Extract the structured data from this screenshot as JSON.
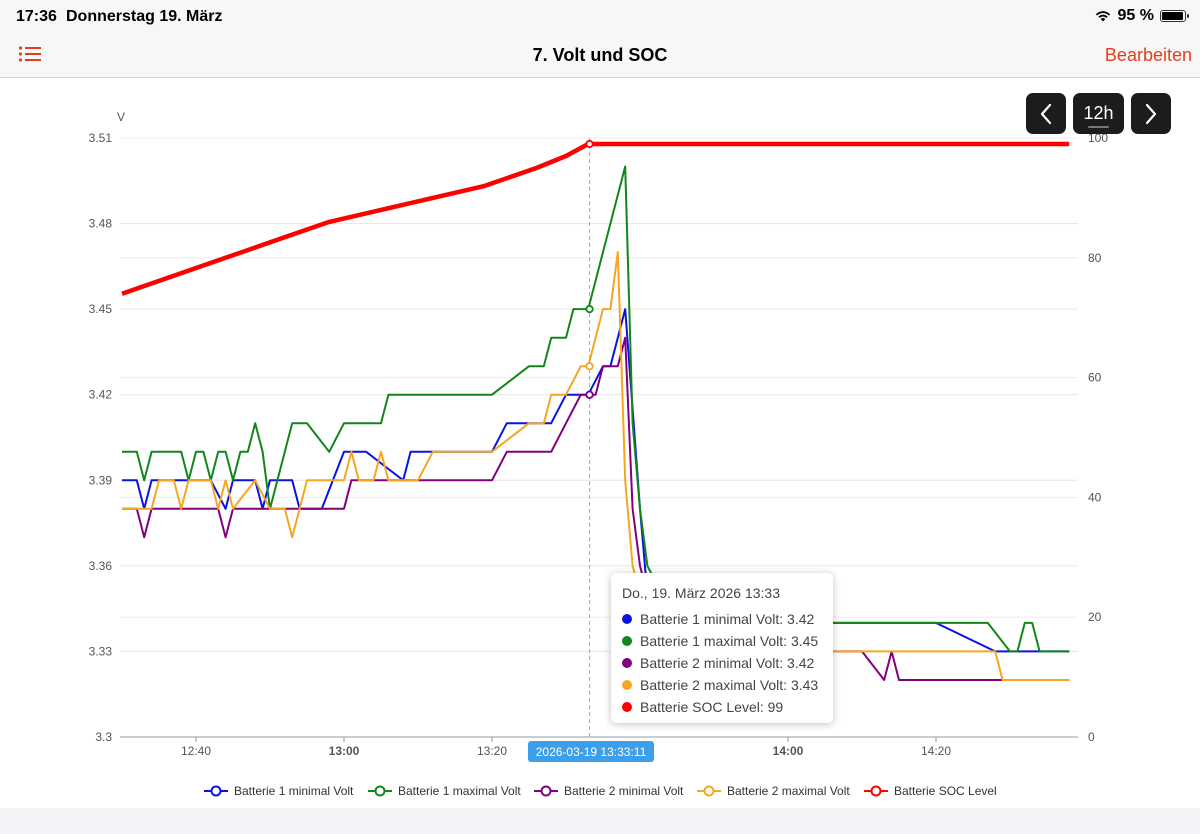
{
  "status": {
    "time": "17:36",
    "date": "Donnerstag 19. März",
    "battery": "95 %"
  },
  "nav": {
    "title": "7. Volt und SOC",
    "edit_label": "Bearbeiten"
  },
  "controls": {
    "range_label": "12h"
  },
  "tooltip": {
    "title": "Do., 19. März 2026 13:33",
    "rows": [
      {
        "label": "Batterie 1 minimal Volt: 3.42",
        "color": "#0a14e0"
      },
      {
        "label": "Batterie 1 maximal Volt: 3.45",
        "color": "#12861a"
      },
      {
        "label": "Batterie 2 minimal Volt: 3.42",
        "color": "#800080"
      },
      {
        "label": "Batterie 2 maximal Volt: 3.43",
        "color": "#f5a623"
      },
      {
        "label": "Batterie SOC Level: 99",
        "color": "#ff0000"
      }
    ]
  },
  "crosshair": {
    "label": "2026-03-19 13:33:11",
    "x": "13:33:11"
  },
  "chart_data": {
    "type": "line",
    "left_axis": {
      "unit": "V",
      "ticks": [
        "3.3",
        "3.33",
        "3.36",
        "3.39",
        "3.42",
        "3.45",
        "3.48",
        "3.51"
      ],
      "range": [
        3.3,
        3.51
      ]
    },
    "right_axis": {
      "ticks": [
        "0",
        "20",
        "40",
        "60",
        "80",
        "100"
      ],
      "range": [
        0,
        100
      ]
    },
    "x_ticks": [
      {
        "label": "12:40",
        "bold": false
      },
      {
        "label": "13:00",
        "bold": true
      },
      {
        "label": "13:20",
        "bold": false
      },
      {
        "label": "14:00",
        "bold": true
      },
      {
        "label": "14:20",
        "bold": false
      }
    ],
    "x_range": [
      "12:40",
      "14:20"
    ],
    "grid": true,
    "legend_position": "bottom",
    "series": [
      {
        "name": "Batterie 1 minimal Volt",
        "color": "#0a14e0",
        "axis": "left",
        "x": [
          "12:30",
          "12:32",
          "12:33",
          "12:34",
          "12:38",
          "12:42",
          "12:44",
          "12:45",
          "12:48",
          "12:49",
          "12:50",
          "12:53",
          "12:54",
          "12:56",
          "12:57",
          "13:00",
          "13:02",
          "13:03",
          "13:08",
          "13:09",
          "13:15",
          "13:20",
          "13:22",
          "13:28",
          "13:30",
          "13:33",
          "13:35",
          "13:36",
          "13:37",
          "13:38",
          "13:40",
          "13:41",
          "13:45",
          "14:00",
          "14:10",
          "14:20",
          "14:28",
          "14:38"
        ],
        "y": [
          3.39,
          3.39,
          3.38,
          3.39,
          3.39,
          3.39,
          3.38,
          3.39,
          3.39,
          3.38,
          3.39,
          3.39,
          3.38,
          3.38,
          3.38,
          3.4,
          3.4,
          3.4,
          3.39,
          3.4,
          3.4,
          3.4,
          3.41,
          3.41,
          3.42,
          3.42,
          3.43,
          3.43,
          3.44,
          3.45,
          3.38,
          3.35,
          3.34,
          3.34,
          3.34,
          3.34,
          3.33,
          3.33
        ]
      },
      {
        "name": "Batterie 1 maximal Volt",
        "color": "#12861a",
        "axis": "left",
        "x": [
          "12:30",
          "12:32",
          "12:33",
          "12:34",
          "12:38",
          "12:39",
          "12:40",
          "12:41",
          "12:42",
          "12:43",
          "12:44",
          "12:45",
          "12:46",
          "12:47",
          "12:48",
          "12:49",
          "12:50",
          "12:51",
          "12:52",
          "12:53",
          "12:55",
          "12:58",
          "13:00",
          "13:01",
          "13:02",
          "13:05",
          "13:06",
          "13:10",
          "13:18",
          "13:20",
          "13:25",
          "13:27",
          "13:28",
          "13:30",
          "13:31",
          "13:32",
          "13:33",
          "13:38",
          "13:39",
          "13:40",
          "13:41",
          "13:43",
          "13:45",
          "13:50",
          "14:00",
          "14:20",
          "14:26",
          "14:27",
          "14:30",
          "14:31",
          "14:32",
          "14:33",
          "14:34",
          "14:35",
          "14:38"
        ],
        "y": [
          3.4,
          3.4,
          3.39,
          3.4,
          3.4,
          3.39,
          3.4,
          3.4,
          3.39,
          3.4,
          3.4,
          3.39,
          3.4,
          3.4,
          3.41,
          3.4,
          3.38,
          3.39,
          3.4,
          3.41,
          3.41,
          3.4,
          3.41,
          3.41,
          3.41,
          3.41,
          3.42,
          3.42,
          3.42,
          3.42,
          3.43,
          3.43,
          3.44,
          3.44,
          3.45,
          3.45,
          3.45,
          3.5,
          3.41,
          3.38,
          3.36,
          3.35,
          3.34,
          3.34,
          3.34,
          3.34,
          3.34,
          3.34,
          3.33,
          3.33,
          3.34,
          3.34,
          3.33,
          3.33,
          3.33
        ]
      },
      {
        "name": "Batterie 2 minimal Volt",
        "color": "#800080",
        "axis": "left",
        "x": [
          "12:30",
          "12:32",
          "12:33",
          "12:34",
          "12:38",
          "12:40",
          "12:43",
          "12:44",
          "12:45",
          "12:50",
          "12:53",
          "12:54",
          "12:55",
          "12:56",
          "13:00",
          "13:01",
          "13:02",
          "13:05",
          "13:06",
          "13:10",
          "13:15",
          "13:20",
          "13:22",
          "13:28",
          "13:30",
          "13:32",
          "13:33",
          "13:34",
          "13:35",
          "13:37",
          "13:38",
          "13:39",
          "13:40",
          "13:42",
          "13:45",
          "14:00",
          "14:10",
          "14:13",
          "14:14",
          "14:15",
          "14:20",
          "14:30",
          "14:38"
        ],
        "y": [
          3.38,
          3.38,
          3.37,
          3.38,
          3.38,
          3.38,
          3.38,
          3.37,
          3.38,
          3.38,
          3.38,
          3.38,
          3.38,
          3.38,
          3.38,
          3.39,
          3.39,
          3.39,
          3.39,
          3.39,
          3.39,
          3.39,
          3.4,
          3.4,
          3.41,
          3.42,
          3.42,
          3.42,
          3.43,
          3.43,
          3.44,
          3.38,
          3.36,
          3.34,
          3.33,
          3.33,
          3.33,
          3.32,
          3.33,
          3.32,
          3.32,
          3.32,
          3.32
        ]
      },
      {
        "name": "Batterie 2 maximal Volt",
        "color": "#f5a623",
        "axis": "left",
        "x": [
          "12:30",
          "12:32",
          "12:34",
          "12:35",
          "12:37",
          "12:38",
          "12:39",
          "12:40",
          "12:42",
          "12:43",
          "12:44",
          "12:45",
          "12:48",
          "12:50",
          "12:52",
          "12:53",
          "12:54",
          "12:55",
          "12:56",
          "12:58",
          "13:00",
          "13:01",
          "13:02",
          "13:04",
          "13:05",
          "13:06",
          "13:07",
          "13:08",
          "13:10",
          "13:12",
          "13:20",
          "13:25",
          "13:27",
          "13:28",
          "13:30",
          "13:32",
          "13:33",
          "13:35",
          "13:36",
          "13:37",
          "13:38",
          "13:39",
          "13:41",
          "13:45",
          "14:00",
          "14:25",
          "14:28",
          "14:29",
          "14:30",
          "14:31",
          "14:38"
        ],
        "y": [
          3.38,
          3.38,
          3.38,
          3.39,
          3.39,
          3.38,
          3.39,
          3.39,
          3.39,
          3.38,
          3.39,
          3.38,
          3.39,
          3.38,
          3.38,
          3.37,
          3.38,
          3.39,
          3.39,
          3.39,
          3.39,
          3.4,
          3.39,
          3.39,
          3.4,
          3.39,
          3.39,
          3.39,
          3.39,
          3.4,
          3.4,
          3.41,
          3.41,
          3.42,
          3.42,
          3.43,
          3.43,
          3.45,
          3.45,
          3.47,
          3.39,
          3.36,
          3.34,
          3.33,
          3.33,
          3.33,
          3.33,
          3.32,
          3.32,
          3.32,
          3.32
        ]
      },
      {
        "name": "Batterie SOC Level",
        "color": "#ff0000",
        "axis": "right",
        "x": [
          "12:30",
          "12:37",
          "12:44",
          "12:51",
          "12:58",
          "13:05",
          "13:12",
          "13:19",
          "13:26",
          "13:30",
          "13:33",
          "13:38",
          "14:38"
        ],
        "y": [
          74,
          77,
          80,
          83,
          86,
          88,
          90,
          92,
          95,
          97,
          99,
          99,
          99
        ]
      }
    ]
  }
}
